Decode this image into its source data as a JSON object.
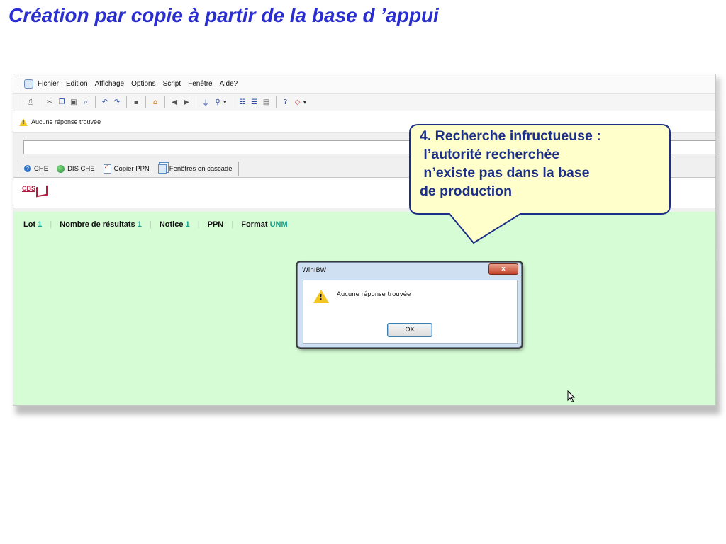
{
  "slide": {
    "title": "Création par copie à partir de la base d ’appui"
  },
  "window": {
    "menu": {
      "items": [
        "Fichier",
        "Edition",
        "Affichage",
        "Options",
        "Script",
        "Fenêtre",
        "Aide?"
      ]
    },
    "toolbar_icons": [
      "print-icon",
      "cut-icon",
      "copy-icon",
      "paste-icon",
      "find-icon",
      "undo-icon",
      "redo-icon",
      "save-icon",
      "home-icon",
      "back-icon",
      "forward-icon",
      "filter-icon",
      "search-dropdown-icon",
      "data-icon",
      "list-icon",
      "doc-icon",
      "help-icon",
      "eraser-icon"
    ],
    "status_message": "Aucune réponse trouvée",
    "command_input_value": "",
    "quick_buttons": [
      {
        "label": "CHE",
        "icon": "help-circle-icon"
      },
      {
        "label": "DIS CHE",
        "icon": "globe-icon"
      },
      {
        "label": "Copier PPN",
        "icon": "doc-check-icon"
      },
      {
        "label": "Fenêtres en cascade",
        "icon": "cascade-windows-icon"
      }
    ],
    "logo_text": "CBS",
    "info": {
      "lot_label": "Lot",
      "lot_value": "1",
      "results_label": "Nombre de résultats",
      "results_value": "1",
      "notice_label": "Notice",
      "notice_value": "1",
      "ppn_label": "PPN",
      "ppn_value": "",
      "format_label": "Format",
      "format_value": "UNM"
    }
  },
  "dialog": {
    "title": "WinIBW",
    "close_label": "x",
    "message": "Aucune réponse trouvée",
    "ok_label": "OK"
  },
  "callout": {
    "text": "4. Recherche infructueuse :\n l’autorité recherchée\n n’existe pas dans la base\nde production",
    "fill": "#ffffcc",
    "border": "#1c2f87",
    "text_color": "#1c2f87"
  },
  "colors": {
    "title": "#2a2ed0",
    "content_bg": "#d6fcd6",
    "info_value": "#1aa08a"
  }
}
